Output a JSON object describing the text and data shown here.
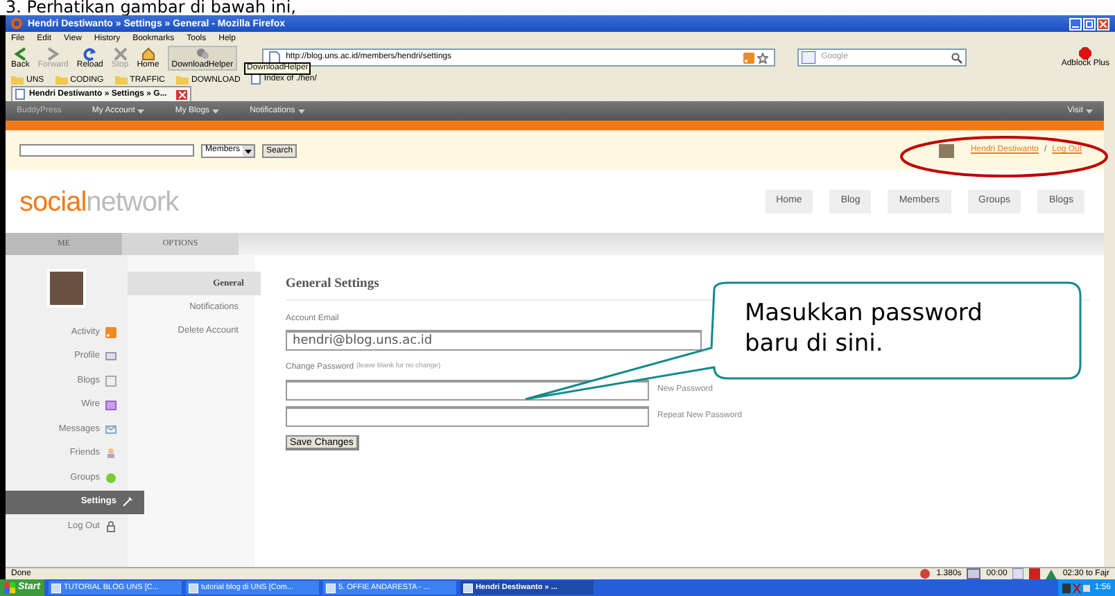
{
  "document_caption": "3. Perhatikan gambar di bawah ini,",
  "window": {
    "title": "Hendri Destiwanto » Settings » General - Mozilla Firefox"
  },
  "menu": [
    "File",
    "Edit",
    "View",
    "History",
    "Bookmarks",
    "Tools",
    "Help"
  ],
  "toolbar": [
    {
      "label": "Back",
      "kind": "back",
      "disabled": false
    },
    {
      "label": "Forward",
      "kind": "forward",
      "disabled": true
    },
    {
      "label": "Reload",
      "kind": "reload",
      "disabled": false
    },
    {
      "label": "Stop",
      "kind": "stop",
      "disabled": true
    },
    {
      "label": "Home",
      "kind": "home",
      "disabled": false
    },
    {
      "label": "DownloadHelper",
      "kind": "download",
      "disabled": false
    }
  ],
  "tooltip": "DownloadHelper",
  "address": "http://blog.uns.ac.id/members/hendri/settings",
  "search_placeholder": "Google",
  "adblock": "Adblock Plus",
  "bookmarks": [
    {
      "label": "UNS",
      "kind": "folder"
    },
    {
      "label": "CODING",
      "kind": "folder"
    },
    {
      "label": "TRAFFIC",
      "kind": "folder"
    },
    {
      "label": "DOWNLOAD",
      "kind": "folder"
    },
    {
      "label": "Index of ./hen/",
      "kind": "page"
    }
  ],
  "tab": {
    "title": "Hendri Destiwanto » Settings » G..."
  },
  "adminbar": {
    "brand": "BuddyPress",
    "items": [
      "My Account",
      "My Blogs",
      "Notifications"
    ],
    "visit": "Visit"
  },
  "searchbar": {
    "scope": "Members",
    "button": "Search",
    "user": "Hendri Destiwanto",
    "separator": "/",
    "logout": "Log Out"
  },
  "logo": {
    "first": "social",
    "second": "network"
  },
  "nav": [
    "Home",
    "Blog",
    "Members",
    "Groups",
    "Blogs"
  ],
  "subtabs": [
    {
      "label": "ME",
      "selected": true
    },
    {
      "label": "OPTIONS",
      "selected": false
    }
  ],
  "sidebar": [
    {
      "label": "Activity",
      "kind": "rss",
      "selected": false
    },
    {
      "label": "Profile",
      "kind": "profile",
      "selected": false
    },
    {
      "label": "Blogs",
      "kind": "blogs",
      "selected": false
    },
    {
      "label": "Wire",
      "kind": "wire",
      "selected": false
    },
    {
      "label": "Messages",
      "kind": "messages",
      "selected": false
    },
    {
      "label": "Friends",
      "kind": "friends",
      "selected": false
    },
    {
      "label": "Groups",
      "kind": "groups",
      "selected": false
    },
    {
      "label": "Settings",
      "kind": "settings",
      "selected": true
    },
    {
      "label": "Log Out",
      "kind": "logout",
      "selected": false
    }
  ],
  "options": [
    {
      "label": "General",
      "selected": true
    },
    {
      "label": "Notifications",
      "selected": false
    },
    {
      "label": "Delete Account",
      "selected": false
    }
  ],
  "form": {
    "title": "General Settings",
    "email_label": "Account Email",
    "email": "hendri@blog.uns.ac.id",
    "password_label": "Change Password",
    "password_hint": "(leave blank for no change)",
    "new_label": "New Password",
    "repeat_label": "Repeat New Password",
    "save": "Save Changes"
  },
  "callout": "Masukkan password baru di sini.",
  "status": {
    "text": "Done",
    "timing": "1.380s",
    "timer": "00:00",
    "prayer": "02:30 to Fajr"
  },
  "taskbar": {
    "start": "Start",
    "tasks": [
      {
        "label": "TUTORIAL BLOG UNS [C...",
        "selected": false
      },
      {
        "label": "tutorial blog di UNS [Com...",
        "selected": false
      },
      {
        "label": "5. OFFIE ANDARESTA - ...",
        "selected": false
      },
      {
        "label": "Hendri Destiwanto » ...",
        "selected": true
      }
    ],
    "clock": "1:56"
  }
}
